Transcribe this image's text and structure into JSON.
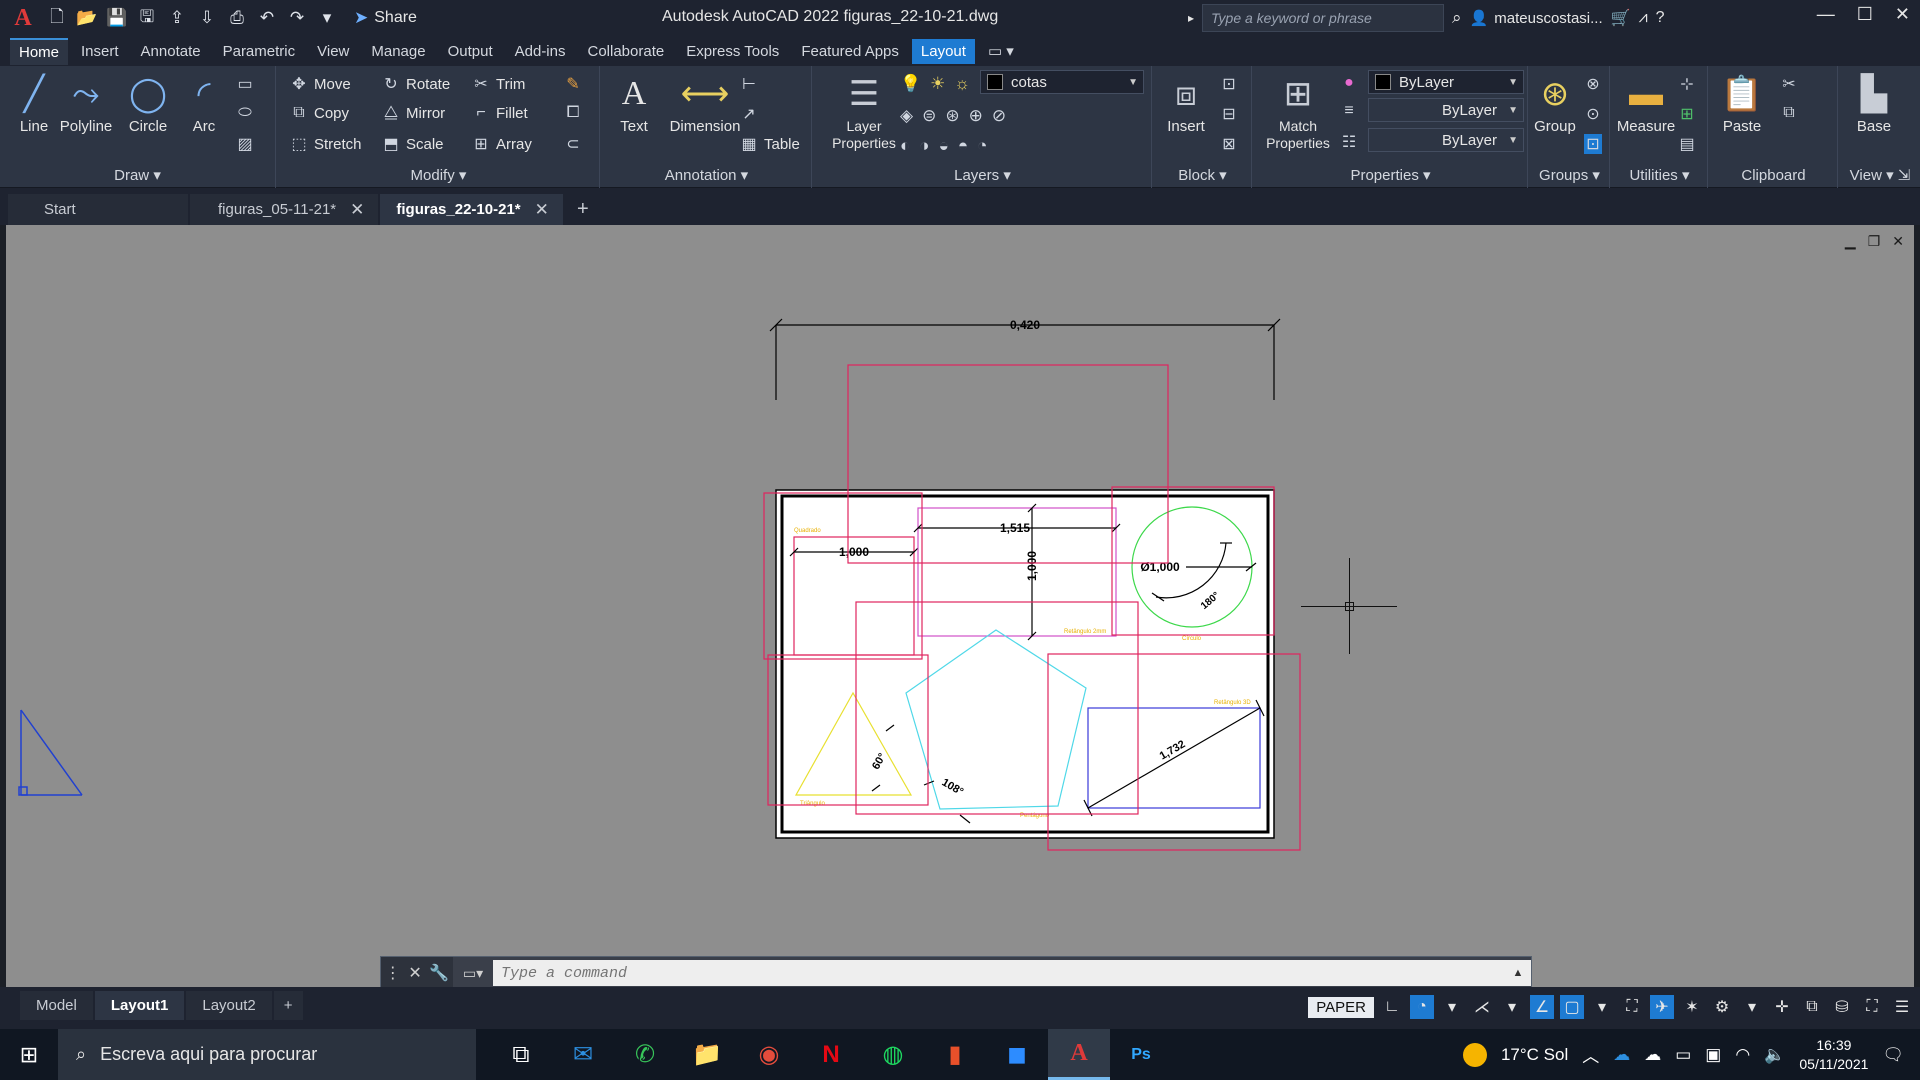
{
  "window": {
    "title": "Autodesk AutoCAD 2022   figuras_22-10-21.dwg",
    "share": "Share",
    "search_placeholder": "Type a keyword or phrase",
    "user": "mateuscostasi..."
  },
  "ribbon_tabs": [
    "Home",
    "Insert",
    "Annotate",
    "Parametric",
    "View",
    "Manage",
    "Output",
    "Add-ins",
    "Collaborate",
    "Express Tools",
    "Featured Apps",
    "Layout"
  ],
  "ribbon": {
    "draw": {
      "title": "Draw",
      "line": "Line",
      "polyline": "Polyline",
      "circle": "Circle",
      "arc": "Arc"
    },
    "modify": {
      "title": "Modify",
      "move": "Move",
      "rotate": "Rotate",
      "trim": "Trim",
      "copy": "Copy",
      "mirror": "Mirror",
      "fillet": "Fillet",
      "stretch": "Stretch",
      "scale": "Scale",
      "array": "Array"
    },
    "annotation": {
      "title": "Annotation",
      "text": "Text",
      "dimension": "Dimension",
      "table": "Table"
    },
    "layers": {
      "title": "Layers",
      "layer_properties": "Layer Properties",
      "current_layer": "cotas"
    },
    "block": {
      "title": "Block",
      "insert": "Insert"
    },
    "properties": {
      "title": "Properties",
      "match": "Match Properties",
      "color": "ByLayer",
      "linetype": "ByLayer",
      "lineweight": "ByLayer"
    },
    "groups": {
      "title": "Groups",
      "group": "Group"
    },
    "utilities": {
      "title": "Utilities",
      "measure": "Measure"
    },
    "clipboard": {
      "title": "Clipboard",
      "paste": "Paste"
    },
    "view": {
      "title": "View",
      "base": "Base"
    }
  },
  "doc_tabs": [
    {
      "label": "Start"
    },
    {
      "label": "figuras_05-11-21*"
    },
    {
      "label": "figuras_22-10-21*"
    }
  ],
  "drawing": {
    "dim_top": "0,420",
    "dim_square": "1,000",
    "dim_rect_w": "1,515",
    "dim_rect_h": "1,000",
    "dim_circle": "Ø1,000",
    "dim_angle_circle": "180°",
    "dim_triangle": "60°",
    "dim_pentagon": "108°",
    "dim_diag": "1,732",
    "label_square": "Quadrado",
    "label_rect": "Retângulo 2mm",
    "label_circle": "Círculo",
    "label_triangle": "Triângulo",
    "label_pentagon": "Pentágono",
    "label_rect2": "Retângulo 3D"
  },
  "command": {
    "placeholder": "Type a command"
  },
  "layout_tabs": [
    "Model",
    "Layout1",
    "Layout2"
  ],
  "status": {
    "paper": "PAPER"
  },
  "taskbar": {
    "search": "Escreva aqui para procurar",
    "weather": "17°C  Sol",
    "time": "16:39",
    "date": "05/11/2021"
  },
  "colors": {
    "accent": "#1e7bd2",
    "viewport_frame": "#e0245e",
    "magenta": "#d050c8",
    "cyan": "#4fd8e8",
    "green": "#3cd84a",
    "yellow": "#e8e030",
    "blue": "#3a3ad8"
  }
}
